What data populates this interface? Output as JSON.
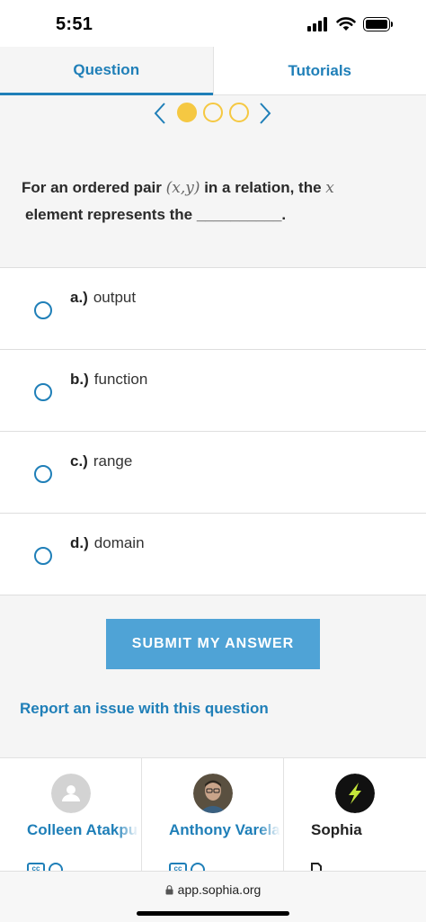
{
  "status_bar": {
    "time": "5:51"
  },
  "tabs": [
    {
      "label": "Question",
      "active": true
    },
    {
      "label": "Tutorials",
      "active": false
    }
  ],
  "pager": {
    "total": 3,
    "current": 1,
    "accent_color": "#f5c842"
  },
  "question": {
    "prefix": "For an ordered pair ",
    "pair": "(x,y)",
    "middle": " in a relation, the ",
    "variable": "x",
    "line2": "element represents the __________."
  },
  "options": [
    {
      "letter": "a.)",
      "text": "output"
    },
    {
      "letter": "b.)",
      "text": "function"
    },
    {
      "letter": "c.)",
      "text": "range"
    },
    {
      "letter": "d.)",
      "text": "domain"
    }
  ],
  "submit": {
    "label": "SUBMIT MY ANSWER",
    "color": "#4fa3d6"
  },
  "report_link": {
    "label": "Report an issue with this question"
  },
  "tutorials": [
    {
      "name": "Colleen Atakpu",
      "avatar": "placeholder-person-icon"
    },
    {
      "name": "Anthony Varela",
      "avatar": "photo"
    },
    {
      "name": "Sophia",
      "avatar": "sophia-logo-icon"
    }
  ],
  "url_bar": {
    "url": "app.sophia.org"
  },
  "colors": {
    "link": "#1f7fb8",
    "background": "#f5f5f5"
  }
}
